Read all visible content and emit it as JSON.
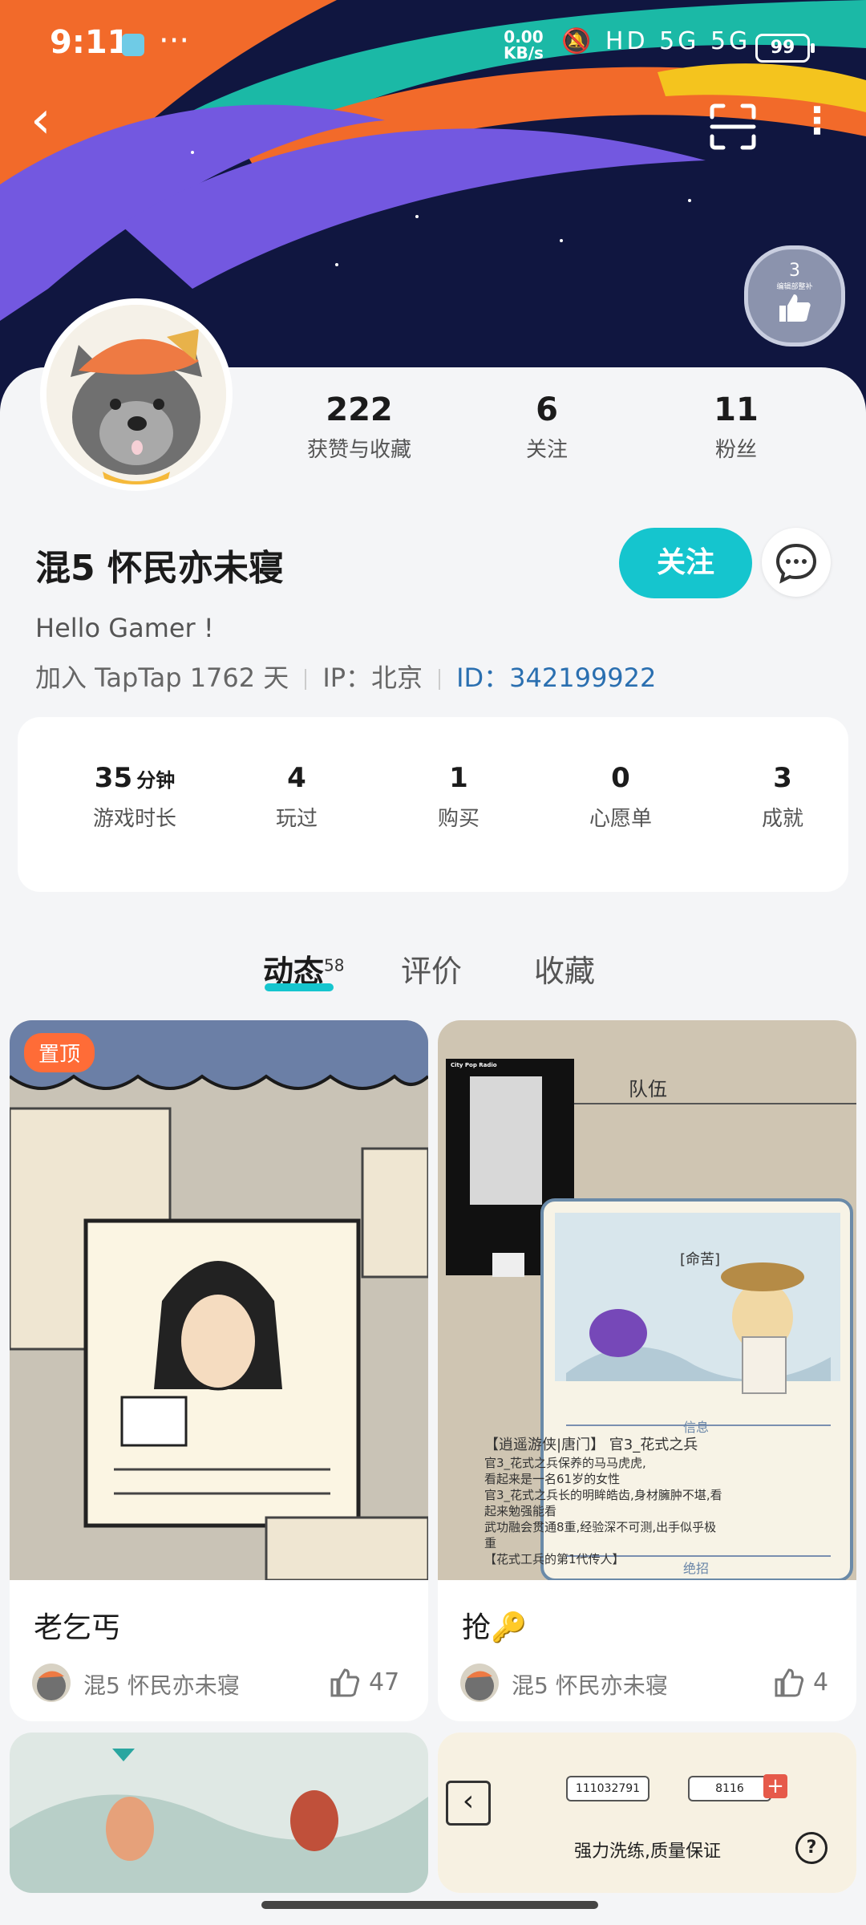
{
  "status_bar": {
    "time": "9:11",
    "dots": "···",
    "net_speed_value": "0.00",
    "net_speed_unit": "KB/s",
    "signal_icons": "🔕 HD 5G 5G",
    "battery": "99"
  },
  "badge": {
    "number": "3",
    "text": "编辑部整补"
  },
  "profile": {
    "stats": [
      {
        "value": "222",
        "label": "获赞与收藏"
      },
      {
        "value": "6",
        "label": "关注"
      },
      {
        "value": "11",
        "label": "粉丝"
      }
    ],
    "name": "混5 怀民亦未寝",
    "follow_label": "关注",
    "bio": "Hello Gamer !",
    "joined": "加入 TapTap 1762 天",
    "ip": "IP：北京",
    "id": "ID：342199922"
  },
  "game_stats": [
    {
      "value": "35",
      "unit": "分钟",
      "label": "游戏时长"
    },
    {
      "value": "4",
      "unit": "",
      "label": "玩过"
    },
    {
      "value": "1",
      "unit": "",
      "label": "购买"
    },
    {
      "value": "0",
      "unit": "",
      "label": "心愿单"
    },
    {
      "value": "3",
      "unit": "",
      "label": "成就"
    }
  ],
  "tabs": [
    {
      "label": "动态",
      "count": "58"
    },
    {
      "label": "评价"
    },
    {
      "label": "收藏"
    }
  ],
  "posts": [
    {
      "pinned": "置顶",
      "title": "老乞丐",
      "author": "混5 怀民亦未寝",
      "likes": "47"
    },
    {
      "title": "抢🔑",
      "author": "混5 怀民亦未寝",
      "likes": "4",
      "thumb_label": "City Pop Radio",
      "game_card": {
        "header": "队伍",
        "tag": "[命苦]",
        "section": "信息",
        "name": "【逍遥游侠|唐门】 官3_花式之兵",
        "lines": [
          "官3_花式之兵保养的马马虎虎,",
          "看起来是一名61岁的女性",
          "官3_花式之兵长的明眸皓齿,身材臃肿不堪,看起来勉强能看",
          "武功融会贯通8重,经验深不可测,出手似乎极重",
          "【花式工兵的第1代传人】"
        ],
        "footer": "绝招"
      }
    },
    {
      "title": ""
    },
    {
      "counter_left": "111032791",
      "counter_right": "8116",
      "banner": "强力洗练,质量保证",
      "help": "?"
    }
  ],
  "colors": {
    "accent": "#15c5ce",
    "pin": "#ff6c37",
    "id": "#2a6fb0"
  }
}
